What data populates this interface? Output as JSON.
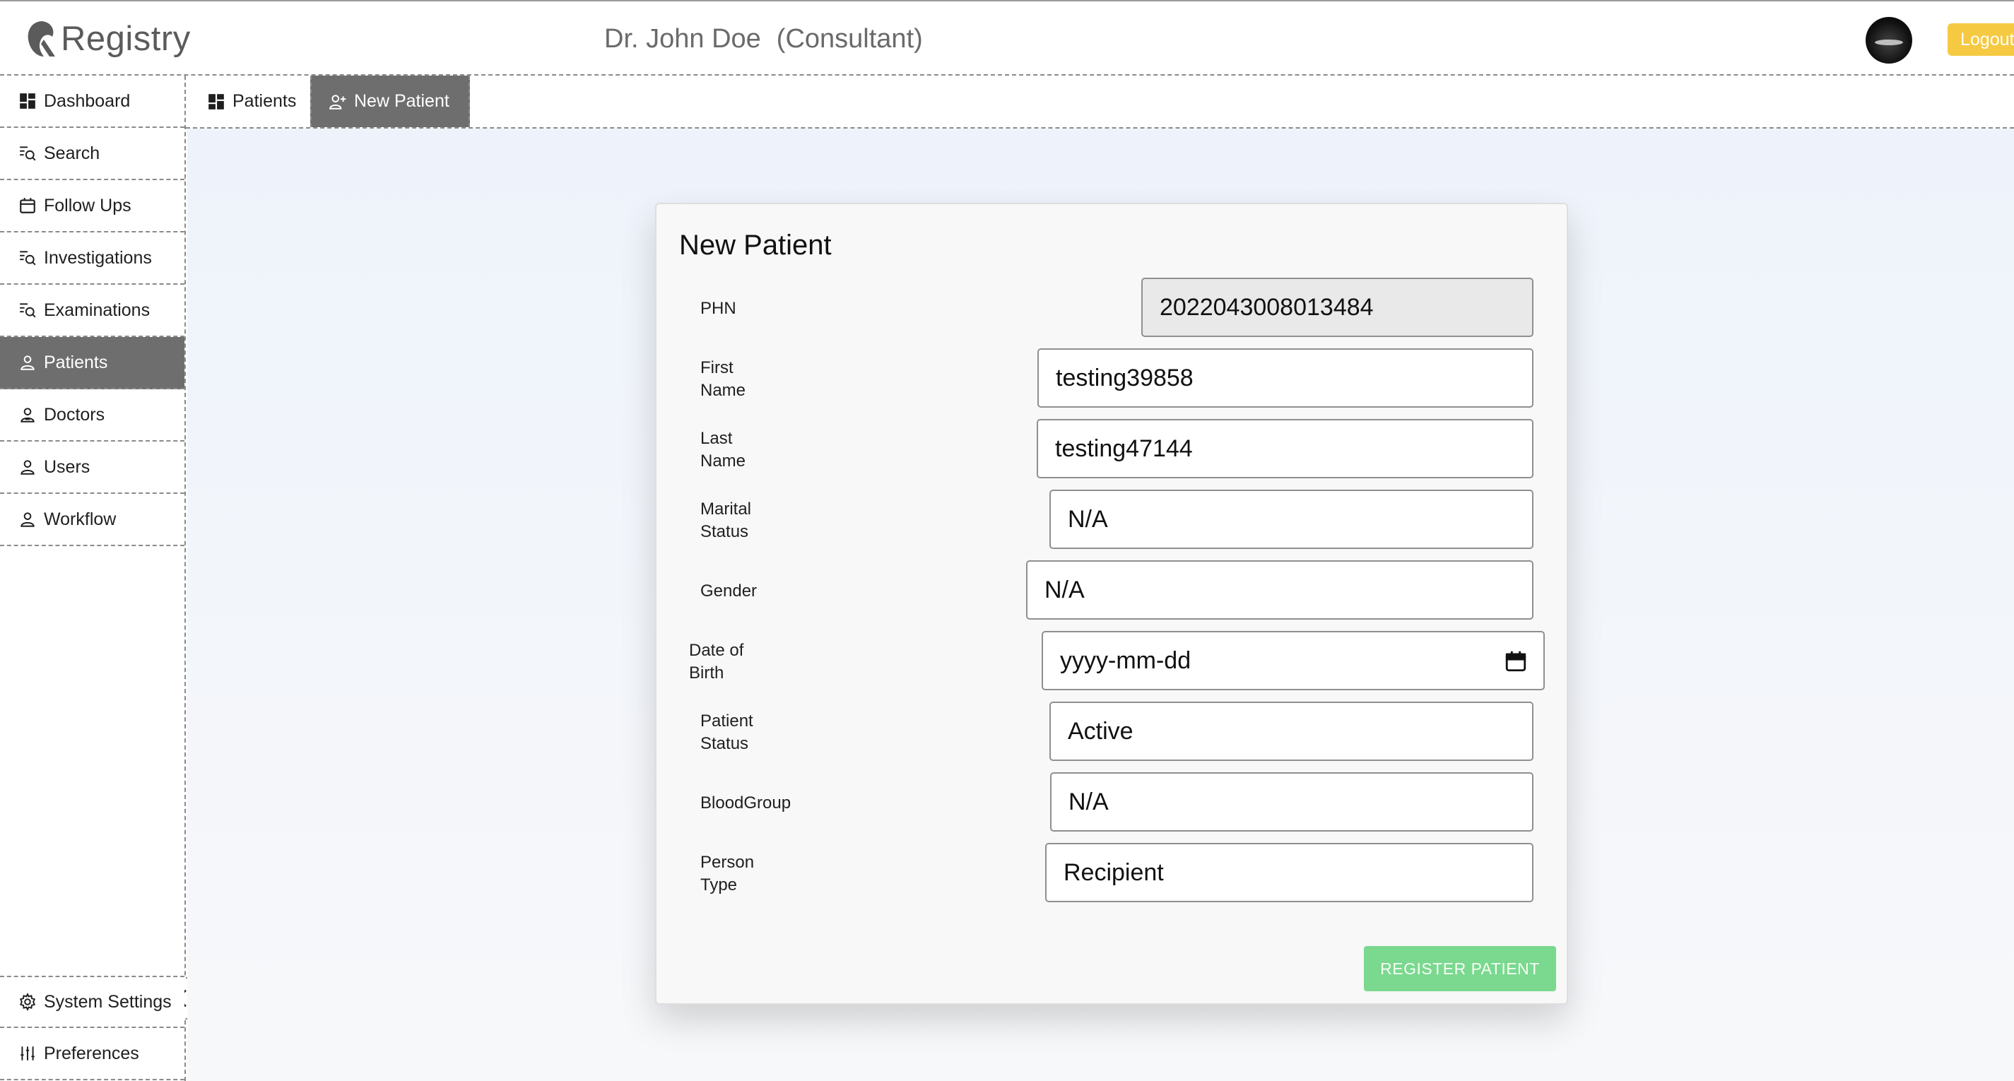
{
  "header": {
    "app_name": "Registry",
    "user_name": "Dr. John Doe",
    "user_role": "(Consultant)",
    "logout_label": "Logout",
    "logout_color": "#f5c942"
  },
  "sidebar": {
    "items": [
      {
        "label": "Dashboard",
        "icon": "dashboard-icon"
      },
      {
        "label": "Search",
        "icon": "search-list-icon"
      },
      {
        "label": "Follow Ups",
        "icon": "calendar-icon"
      },
      {
        "label": "Investigations",
        "icon": "search-list-icon"
      },
      {
        "label": "Examinations",
        "icon": "search-list-icon"
      },
      {
        "label": "Patients",
        "icon": "user-icon",
        "active": true
      },
      {
        "label": "Doctors",
        "icon": "doctor-icon"
      },
      {
        "label": "Users",
        "icon": "user-icon"
      },
      {
        "label": "Workflow",
        "icon": "user-icon"
      }
    ],
    "bottom_items": [
      {
        "label": "System Settings",
        "icon": "gear-icon"
      },
      {
        "label": "Preferences",
        "icon": "sliders-icon"
      }
    ],
    "active_color": "#6e6e6e"
  },
  "tabs": [
    {
      "label": "Patients",
      "icon": "dashboard-icon",
      "active": false
    },
    {
      "label": "New Patient",
      "icon": "add-user-icon",
      "active": true
    }
  ],
  "form": {
    "title": "New Patient",
    "fields": {
      "phn": {
        "label": "PHN",
        "value": "2022043008013484"
      },
      "first_name": {
        "label_line1": "First",
        "label_line2": "Name",
        "value": "testing39858"
      },
      "last_name": {
        "label_line1": "Last",
        "label_line2": "Name",
        "value": "testing47144"
      },
      "marital_status": {
        "label_line1": "Marital",
        "label_line2": "Status",
        "value": "N/A"
      },
      "gender": {
        "label": "Gender",
        "value": "N/A"
      },
      "date_of_birth": {
        "label_line1": "Date of",
        "label_line2": "Birth",
        "placeholder": "yyyy-mm-dd"
      },
      "patient_status": {
        "label_line1": "Patient",
        "label_line2": "Status",
        "value": "Active"
      },
      "blood_group": {
        "label": "BloodGroup",
        "value": "N/A"
      },
      "person_type": {
        "label_line1": "Person",
        "label_line2": "Type",
        "value": "Recipient"
      }
    },
    "register_label": "REGISTER PATIENT",
    "register_color": "#7bd88f"
  }
}
